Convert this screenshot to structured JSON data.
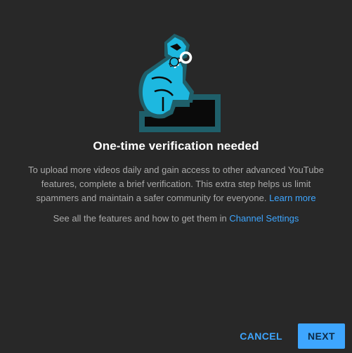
{
  "dialog": {
    "title": "One-time verification needed",
    "body_text": "To upload more videos daily and gain access to other advanced YouTube features, complete a brief verification. This extra step helps us limit spammers and maintain a safer community for everyone.",
    "learn_more_link": "Learn more",
    "features_text": "See all the features and how to get them in",
    "channel_settings_link": "Channel Settings",
    "illustration_icon": "verification-key-stairs-illustration"
  },
  "actions": {
    "cancel_label": "CANCEL",
    "next_label": "NEXT"
  },
  "colors": {
    "background": "#282828",
    "accent": "#3ea6ff",
    "title": "#ffffff",
    "body": "#aaaaaa"
  }
}
